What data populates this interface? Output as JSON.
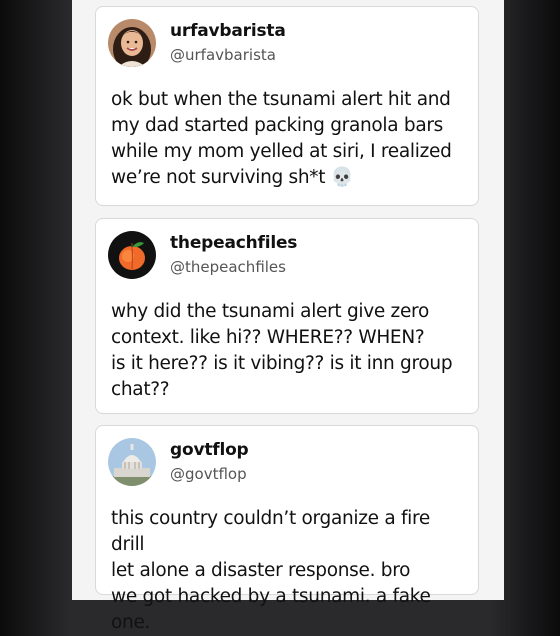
{
  "posts": [
    {
      "name": "urfavbarista",
      "handle": "@urfavbarista",
      "text": "ok but when the tsunami alert hit and\nmy dad started packing granola bars\nwhile my mom yelled at siri, I realized\nwe’re not surviving sh*t 💀",
      "avatar_icon": "portrait-photo-avatar"
    },
    {
      "name": "thepeachfiles",
      "handle": "@thepeachfiles",
      "text": "why did the tsunami alert give zero\ncontext. like hi?? WHERE?? WHEN?\nis it here?? is it vibing?? is it inn group\nchat??",
      "avatar_icon": "peach-icon"
    },
    {
      "name": "govtflop",
      "handle": "@govtflop",
      "text": "this country couldn’t organize a fire drill\nlet alone a disaster response. bro\nwe got hacked by a tsunami. a fake one.",
      "avatar_icon": "capitol-building-icon"
    }
  ],
  "colors": {
    "background_edge": "#0b0b0c",
    "background_mid": "#2a2a2c",
    "column": "#f4f4f4",
    "card": "#ffffff",
    "text": "#111111",
    "handle": "#555555"
  }
}
